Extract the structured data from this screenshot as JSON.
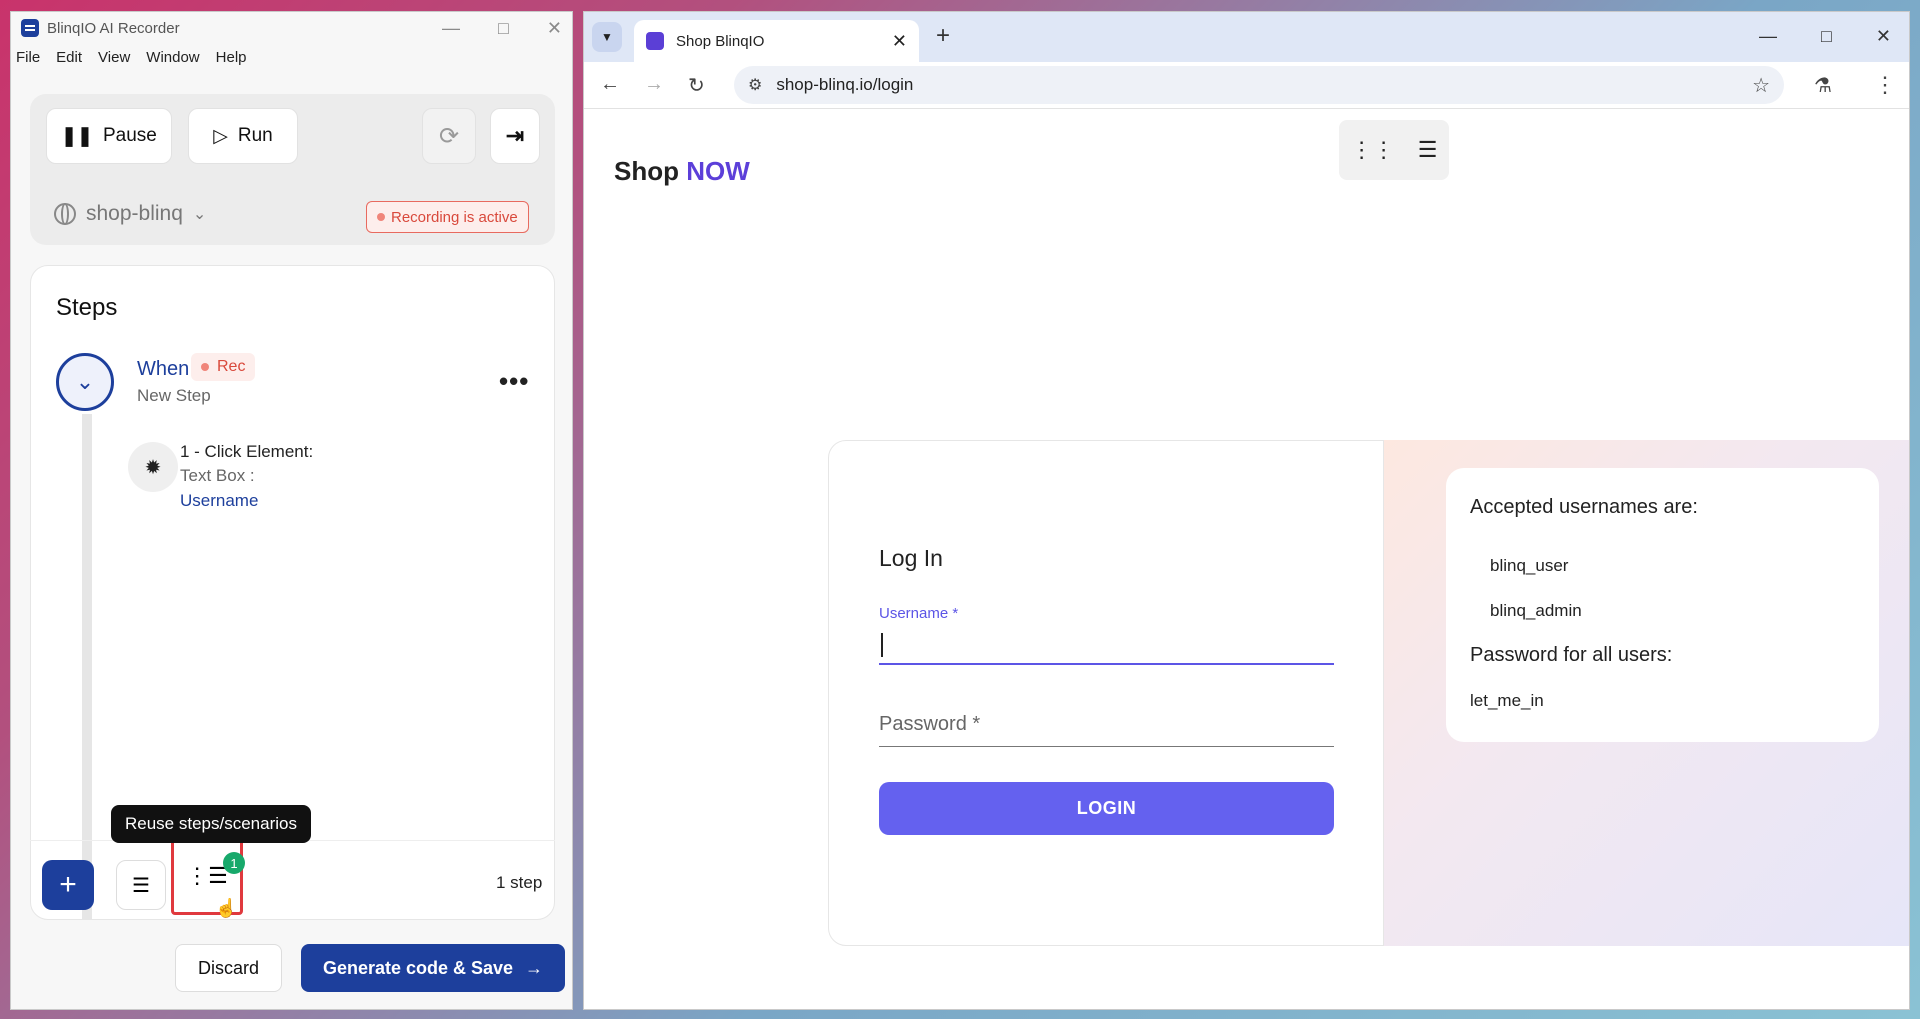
{
  "recorder": {
    "title": "BlinqIO AI Recorder",
    "menu": [
      "File",
      "Edit",
      "View",
      "Window",
      "Help"
    ],
    "pause_label": "Pause",
    "run_label": "Run",
    "project": "shop-blinq",
    "recording_status": "Recording is active",
    "steps_title": "Steps",
    "step": {
      "keyword": "When",
      "rec_label": "Rec",
      "name": "New Step",
      "action_title": "1 - Click Element:",
      "action_sub": "Text Box :",
      "action_target": "Username"
    },
    "tooltip": "Reuse steps/scenarios",
    "reuse_count": "1",
    "step_count": "1 step",
    "discard_label": "Discard",
    "generate_label": "Generate code & Save"
  },
  "browser": {
    "tab_title": "Shop BlinqIO",
    "url": "shop-blinq.io/login"
  },
  "page": {
    "logo_text": "Shop",
    "logo_accent": "NOW",
    "login_title": "Log In",
    "username_label": "Username *",
    "password_placeholder": "Password *",
    "login_button": "LOGIN",
    "info_heading": "Accepted usernames are:",
    "usernames": [
      "blinq_user",
      "blinq_admin"
    ],
    "password_heading": "Password for all users:",
    "password_value": "let_me_in"
  },
  "colors": {
    "brand_blue": "#1d3f9c",
    "accent_purple": "#5c3fd9",
    "login_button": "#6461ef",
    "recording_red": "#d9493c",
    "badge_green": "#17a96b"
  }
}
